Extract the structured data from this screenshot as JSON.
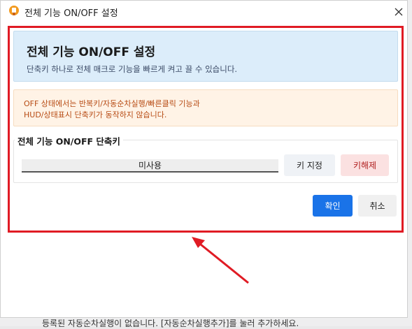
{
  "window": {
    "title": "전체 기능 ON/OFF 설정"
  },
  "info": {
    "title": "전체 기능 ON/OFF 설정",
    "description": "단축키 하나로 전체 매크로 기능을 빠르게 켜고 끌 수 있습니다."
  },
  "warning": {
    "line1": "OFF 상태에서는 반복키/자동순차실행/빠른클릭 기능과",
    "line2": "HUD/상태표시 단축키가 동작하지 않습니다."
  },
  "hotkey": {
    "group_label": "전체 기능 ON/OFF 단축키",
    "value": "미사용",
    "assign_label": "키 지정",
    "release_label": "키해제"
  },
  "footer": {
    "ok_label": "확인",
    "cancel_label": "취소"
  },
  "background": {
    "footer_text": "등록된 자동순차실행이 없습니다. [자동순차실행추가]를 눌러 추가하세요."
  },
  "colors": {
    "highlight": "#e01b24",
    "primary": "#1a73e8",
    "warning_text": "#b74b14"
  },
  "icons": [
    "app-icon",
    "close-icon",
    "arrow-annotation"
  ]
}
